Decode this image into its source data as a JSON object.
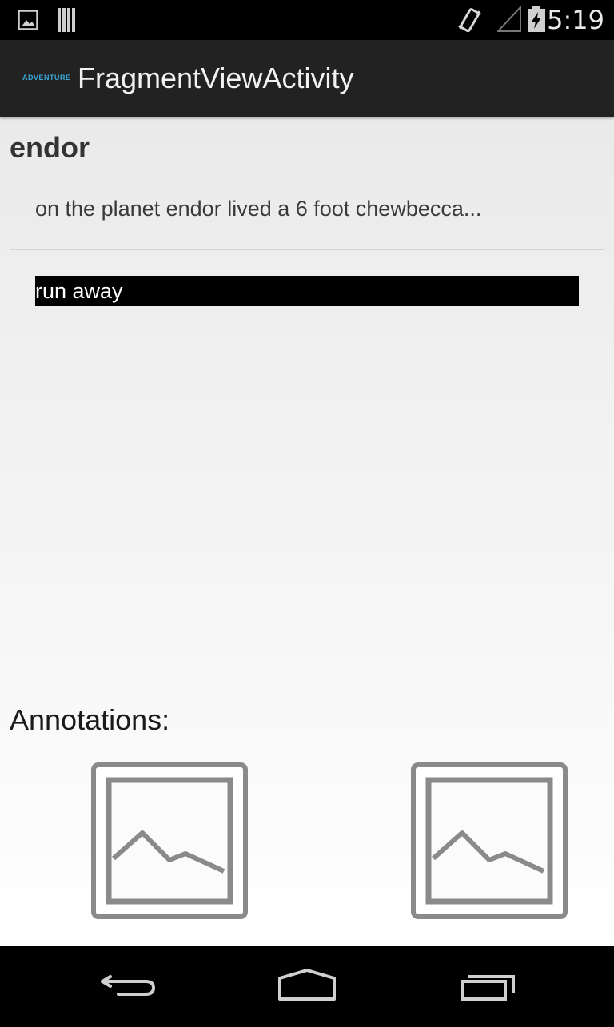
{
  "status_bar": {
    "time": "5:19",
    "icons": [
      "image-notification-icon",
      "barcode-notification-icon",
      "vibrate-icon",
      "no-signal-icon",
      "battery-charging-icon"
    ]
  },
  "action_bar": {
    "app_logo_text": "ADVENTURE",
    "title": "FragmentViewActivity",
    "logo_color": "#3aa8d8"
  },
  "content": {
    "title": "endor",
    "story_text": "on the planet endor lived a 6 foot chewbecca...",
    "choices": [
      "run away"
    ],
    "annotations_label": "Annotations:",
    "annotations": [
      {
        "icon": "image-placeholder-icon"
      },
      {
        "icon": "image-placeholder-icon"
      }
    ]
  },
  "nav_bar": {
    "buttons": [
      "back-icon",
      "home-icon",
      "recent-apps-icon"
    ]
  }
}
